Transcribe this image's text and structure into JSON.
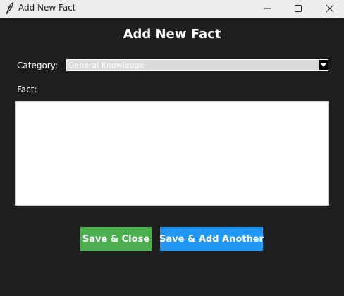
{
  "window": {
    "title": "Add New Fact"
  },
  "dialog": {
    "heading": "Add New Fact",
    "category_label": "Category:",
    "category_value": "General Knowledge",
    "fact_label": "Fact:",
    "fact_value": ""
  },
  "buttons": {
    "save_close": "Save & Close",
    "save_add_another": "Save & Add Another"
  },
  "icons": {
    "app": "feather-icon",
    "minimize": "minimize-icon",
    "maximize": "maximize-icon",
    "close": "close-icon",
    "dropdown": "chevron-down-icon"
  },
  "colors": {
    "background": "#1e1e1e",
    "save_close": "#4caf50",
    "save_add_another": "#2196f3"
  }
}
